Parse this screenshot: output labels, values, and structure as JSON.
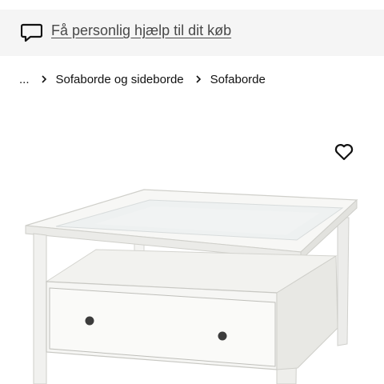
{
  "help_banner": {
    "icon": "chat-bubble-icon",
    "link_text": "Få personlig hjælp til dit køb"
  },
  "breadcrumb": {
    "ellipsis": "...",
    "separator_icon": "chevron-right-icon",
    "items": [
      {
        "label": "Sofaborde og sideborde"
      },
      {
        "label": "Sofaborde"
      }
    ]
  },
  "favourite": {
    "icon": "heart-outline-icon"
  },
  "product_image": {
    "subject": "white coffee table with glass top, shelf and drawer"
  },
  "colors": {
    "banner_bg": "#f5f5f5",
    "text": "#111111",
    "link": "#484848"
  }
}
